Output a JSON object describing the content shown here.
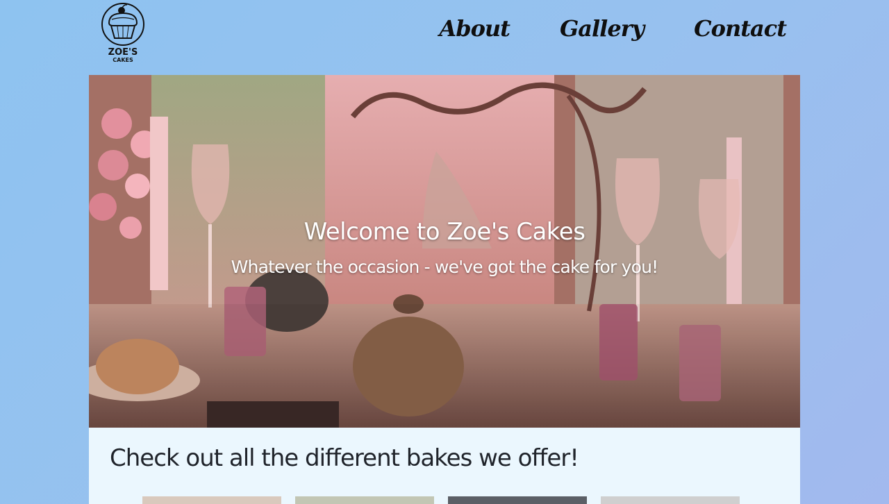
{
  "header": {
    "logo_text_line1": "ZOE'S",
    "logo_text_line2": "CAKES",
    "nav": [
      {
        "label": "About"
      },
      {
        "label": "Gallery"
      },
      {
        "label": "Contact"
      }
    ]
  },
  "hero": {
    "title": "Welcome to Zoe's Cakes",
    "subtitle": "Whatever the occasion - we've got the cake for you!"
  },
  "offers": {
    "heading": "Check out all the different bakes we offer!",
    "thumbnail_colors": [
      "#d9c9bd",
      "#c2c6b4",
      "#5b5f66",
      "#cfcfcf"
    ]
  },
  "colors": {
    "background": "#97c1ef",
    "content_bg": "#ebf7fe",
    "nav_text": "#0f0f0f",
    "heading_text": "#20242b"
  }
}
